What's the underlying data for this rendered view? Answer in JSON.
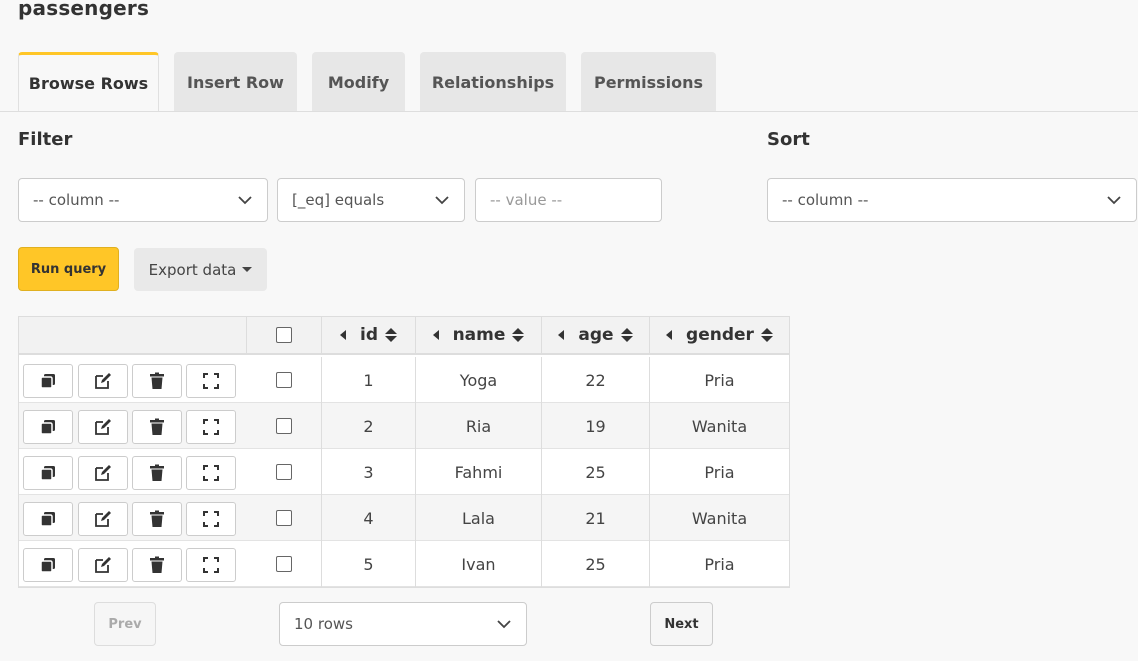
{
  "table_name": "passengers",
  "tabs": [
    {
      "label": "Browse Rows",
      "active": true
    },
    {
      "label": "Insert Row"
    },
    {
      "label": "Modify"
    },
    {
      "label": "Relationships"
    },
    {
      "label": "Permissions"
    }
  ],
  "filter": {
    "label": "Filter",
    "column_value": "-- column --",
    "operator_value": "[_eq] equals",
    "value_placeholder": "-- value --"
  },
  "sort": {
    "label": "Sort",
    "column_value": "-- column --"
  },
  "actions": {
    "run_query": "Run query",
    "export_data": "Export data"
  },
  "grid": {
    "columns": [
      "id",
      "name",
      "age",
      "gender"
    ],
    "rows": [
      {
        "id": "1",
        "name": "Yoga",
        "age": "22",
        "gender": "Pria"
      },
      {
        "id": "2",
        "name": "Ria",
        "age": "19",
        "gender": "Wanita"
      },
      {
        "id": "3",
        "name": "Fahmi",
        "age": "25",
        "gender": "Pria"
      },
      {
        "id": "4",
        "name": "Lala",
        "age": "21",
        "gender": "Wanita"
      },
      {
        "id": "5",
        "name": "Ivan",
        "age": "25",
        "gender": "Pria"
      }
    ],
    "row_action_icons": [
      "clone-icon",
      "edit-icon",
      "trash-icon",
      "expand-icon"
    ]
  },
  "pagination": {
    "prev": "Prev",
    "next": "Next",
    "page_size": "10 rows"
  },
  "colors": {
    "accent": "#ffc627"
  }
}
